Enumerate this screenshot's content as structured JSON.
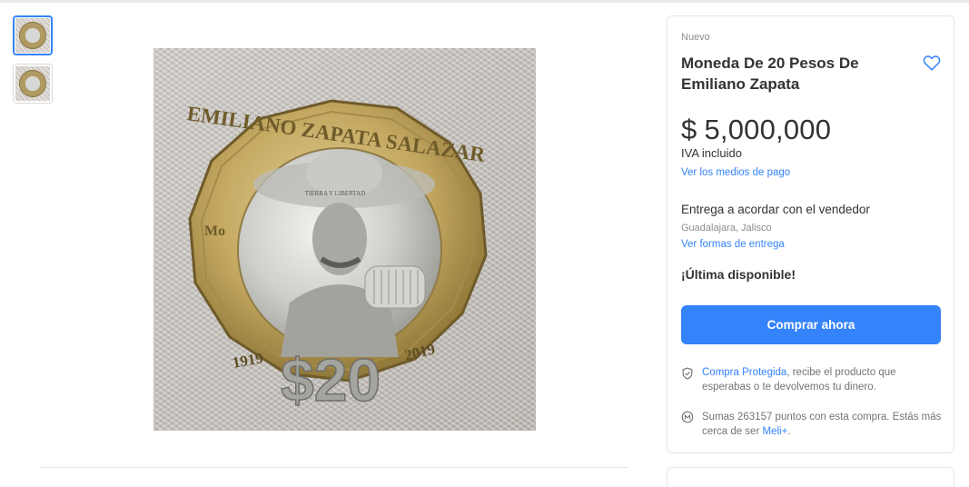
{
  "gallery": {
    "thumbnails": [
      {
        "icon": "coin-thumbnail",
        "selected": true
      },
      {
        "icon": "coin-thumbnail",
        "selected": false
      }
    ],
    "main_image": {
      "coin_top_text": "EMILIANO ZAPATA SALAZAR",
      "motto": "TIERRA Y LIBERTAD",
      "year_left": "1919",
      "year_right": "2019",
      "denomination": "$20",
      "mint_mark": "Mo"
    }
  },
  "product": {
    "condition": "Nuevo",
    "title": "Moneda De 20 Pesos De Emiliano Zapata",
    "price_currency": "$",
    "price_amount": "5,000,000",
    "tax_label": "IVA incluido",
    "payment_link": "Ver los medios de pago",
    "delivery_title": "Entrega a acordar con el vendedor",
    "location": "Guadalajara, Jalisco",
    "delivery_link": "Ver formas de entrega",
    "stock": "¡Última disponible!",
    "buy_button": "Comprar ahora"
  },
  "protection": {
    "link": "Compra Protegida",
    "text": ", recibe el producto que esperabas o te devolvemos tu dinero."
  },
  "points": {
    "text": "Sumas 263157 puntos con esta compra. Estás más cerca de ser ",
    "link": "Meli+",
    "suffix": "."
  },
  "colors": {
    "accent": "#3483fa",
    "text": "#333333",
    "muted": "#8c8c8c"
  }
}
